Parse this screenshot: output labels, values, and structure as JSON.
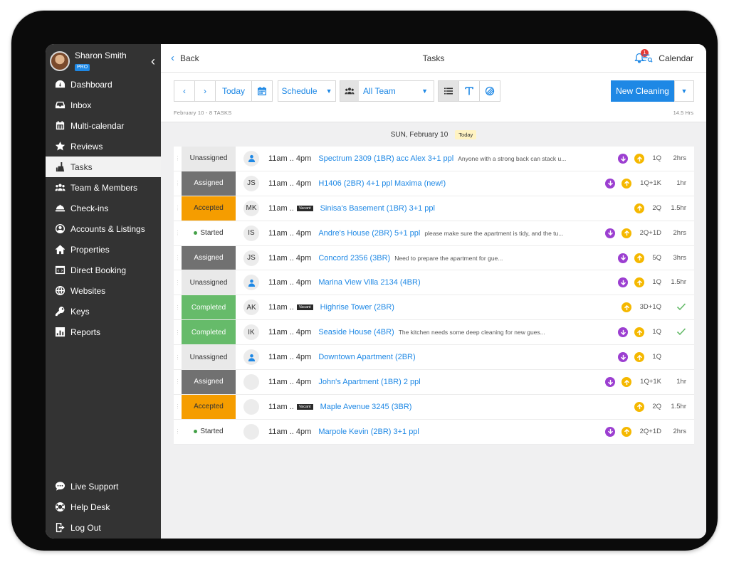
{
  "profile": {
    "name": "Sharon Smith",
    "badge": "PRO"
  },
  "sidebar": {
    "items": [
      {
        "label": "Dashboard",
        "icon": "dashboard-icon"
      },
      {
        "label": "Inbox",
        "icon": "inbox-icon"
      },
      {
        "label": "Multi-calendar",
        "icon": "calendar-icon"
      },
      {
        "label": "Reviews",
        "icon": "star-icon"
      },
      {
        "label": "Tasks",
        "icon": "tasks-icon",
        "active": true
      },
      {
        "label": "Team & Members",
        "icon": "team-icon"
      },
      {
        "label": "Check-ins",
        "icon": "bell-desk-icon"
      },
      {
        "label": "Accounts & Listings",
        "icon": "account-icon"
      },
      {
        "label": "Properties",
        "icon": "home-icon"
      },
      {
        "label": "Direct Booking",
        "icon": "booking-icon"
      },
      {
        "label": "Websites",
        "icon": "globe-icon"
      },
      {
        "label": "Keys",
        "icon": "key-icon"
      },
      {
        "label": "Reports",
        "icon": "reports-icon"
      }
    ],
    "bottom": [
      {
        "label": "Live Support",
        "icon": "chat-icon"
      },
      {
        "label": "Help Desk",
        "icon": "lifebuoy-icon"
      },
      {
        "label": "Log Out",
        "icon": "logout-icon"
      }
    ]
  },
  "header": {
    "back": "Back",
    "title": "Tasks",
    "notifications": "1",
    "calendar": "Calendar"
  },
  "toolbar": {
    "today": "Today",
    "view": "Schedule",
    "team": "All Team",
    "new_cleaning": "New Cleaning",
    "summary": "February 10 - 8 TASKS",
    "hours": "14.5 Hrs"
  },
  "day": {
    "label": "SUN, February 10",
    "tag": "Today"
  },
  "colors": {
    "accent": "#1e88e5",
    "checkout": "#9c3fd1",
    "checkin": "#f5b800",
    "completed": "#66bb6a",
    "accepted": "#f59d00"
  },
  "tasks": [
    {
      "status": "Unassigned",
      "who": "",
      "time": "11am .. 4pm",
      "vacant": false,
      "property": "Spectrum 2309 (1BR) acc Alex 3+1 ppl",
      "note": "Anyone with a strong back can stack u...",
      "out": true,
      "in": true,
      "qty": "1Q",
      "dur": "2hrs",
      "done": false
    },
    {
      "status": "Assigned",
      "who": "JS",
      "time": "11am .. 4pm",
      "vacant": false,
      "property": "H1406 (2BR) 4+1 ppl Maxima (new!)",
      "note": "",
      "out": true,
      "in": true,
      "qty": "1Q+1K",
      "dur": "1hr",
      "done": false
    },
    {
      "status": "Accepted",
      "who": "MK",
      "time": "11am ..",
      "vacant": true,
      "property": "Sinisa's Basement (1BR) 3+1 ppl",
      "note": "",
      "out": false,
      "in": true,
      "qty": "2Q",
      "dur": "1.5hr",
      "done": false
    },
    {
      "status": "Started",
      "who": "IS",
      "time": "11am .. 4pm",
      "vacant": false,
      "property": "Andre's House (2BR) 5+1 ppl",
      "note": "please make sure the apartment is tidy, and the tu...",
      "out": true,
      "in": true,
      "qty": "2Q+1D",
      "dur": "2hrs",
      "done": false
    },
    {
      "status": "Assigned",
      "who": "JS",
      "time": "11am .. 4pm",
      "vacant": false,
      "property": "Concord 2356 (3BR)",
      "note": "Need to prepare the apartment for gue...",
      "out": true,
      "in": true,
      "qty": "5Q",
      "dur": "3hrs",
      "done": false
    },
    {
      "status": "Unassigned",
      "who": "",
      "time": "11am .. 4pm",
      "vacant": false,
      "property": "Marina View Villa 2134 (4BR)",
      "note": "",
      "out": true,
      "in": true,
      "qty": "1Q",
      "dur": "1.5hr",
      "done": false
    },
    {
      "status": "Completed",
      "who": "AK",
      "time": "11am ..",
      "vacant": true,
      "property": "Highrise Tower (2BR)",
      "note": "",
      "out": false,
      "in": true,
      "qty": "3D+1Q",
      "dur": "",
      "done": true
    },
    {
      "status": "Completed",
      "who": "IK",
      "time": "11am .. 4pm",
      "vacant": false,
      "property": "Seaside House (4BR)",
      "note": "The kitchen needs some deep cleaning for new gues...",
      "out": true,
      "in": true,
      "qty": "1Q",
      "dur": "",
      "done": true
    },
    {
      "status": "Unassigned",
      "who": "",
      "time": "11am .. 4pm",
      "vacant": false,
      "property": "Downtown Apartment (2BR)",
      "note": "",
      "out": true,
      "in": true,
      "qty": "1Q",
      "dur": "",
      "done": false
    },
    {
      "status": "Assigned",
      "who": "",
      "time": "11am .. 4pm",
      "vacant": false,
      "property": "John's Apartment (1BR) 2 ppl",
      "note": "",
      "out": true,
      "in": true,
      "qty": "1Q+1K",
      "dur": "1hr",
      "done": false
    },
    {
      "status": "Accepted",
      "who": "",
      "time": "11am ..",
      "vacant": true,
      "property": "Maple Avenue 3245 (3BR)",
      "note": "",
      "out": false,
      "in": true,
      "qty": "2Q",
      "dur": "1.5hr",
      "done": false
    },
    {
      "status": "Started",
      "who": "",
      "time": "11am .. 4pm",
      "vacant": false,
      "property": "Marpole Kevin (2BR) 3+1 ppl",
      "note": "",
      "out": true,
      "in": true,
      "qty": "2Q+1D",
      "dur": "2hrs",
      "done": false
    }
  ],
  "vacant_label": "Vacant"
}
